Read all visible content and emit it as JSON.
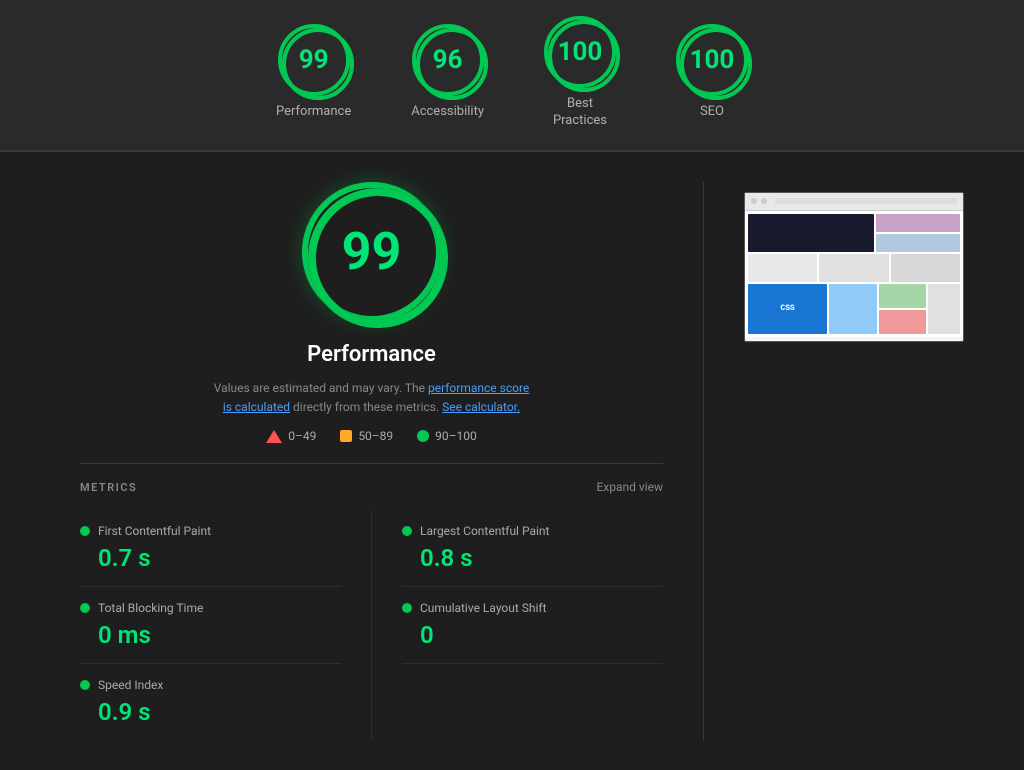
{
  "topBar": {
    "scores": [
      {
        "id": "performance",
        "value": "99",
        "label": "Performance",
        "percent": 99
      },
      {
        "id": "accessibility",
        "value": "96",
        "label": "Accessibility",
        "percent": 96
      },
      {
        "id": "best-practices",
        "value": "100",
        "label": "Best\nPractices",
        "percent": 100
      },
      {
        "id": "seo",
        "value": "100",
        "label": "SEO",
        "percent": 100
      }
    ]
  },
  "mainScore": {
    "value": "99",
    "label": "Performance",
    "percent": 99,
    "description": "Values are estimated and may vary. The",
    "descriptionLink1": "performance score\nis calculated",
    "descriptionMid": "directly from these metrics.",
    "descriptionLink2": "See calculator.",
    "legendItems": [
      {
        "type": "red",
        "range": "0–49"
      },
      {
        "type": "orange",
        "range": "50–89"
      },
      {
        "type": "green",
        "range": "90–100"
      }
    ]
  },
  "metrics": {
    "title": "METRICS",
    "expandLabel": "Expand view",
    "items": [
      {
        "col": 0,
        "name": "First Contentful Paint",
        "value": "0.7 s"
      },
      {
        "col": 1,
        "name": "Largest Contentful Paint",
        "value": "0.8 s"
      },
      {
        "col": 0,
        "name": "Total Blocking Time",
        "value": "0 ms"
      },
      {
        "col": 1,
        "name": "Cumulative Layout Shift",
        "value": "0"
      },
      {
        "col": 0,
        "name": "Speed Index",
        "value": "0.9 s"
      }
    ]
  },
  "colors": {
    "green": "#00e676",
    "greenBorder": "#00c853",
    "background": "#1e1e1e",
    "red": "#ff5252",
    "orange": "#ffa726"
  }
}
